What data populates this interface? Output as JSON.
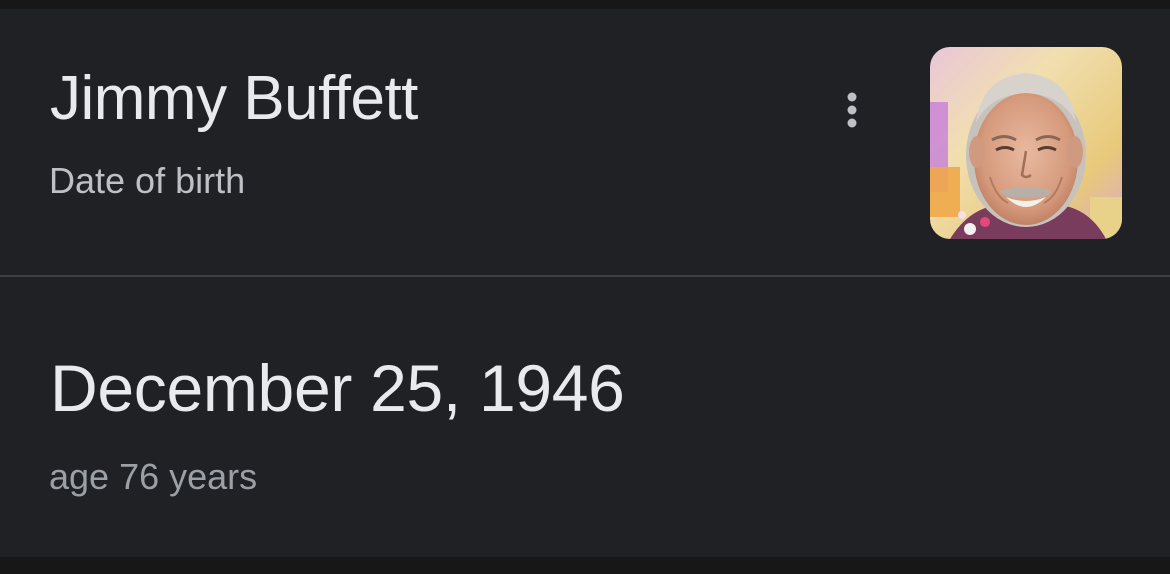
{
  "knowledge_panel": {
    "entity_name": "Jimmy Buffett",
    "attribute_label": "Date of birth",
    "more_options_icon": "three-dots-vertical-icon",
    "thumbnail": "portrait-photo",
    "answer": "December 25, 1946",
    "age_text": "age 76 years"
  },
  "colors": {
    "background": "#202124",
    "outer_background": "#171717",
    "divider": "#3c4043",
    "primary_text": "#e8eaed",
    "secondary_text": "#bdc1c6",
    "tertiary_text": "#9aa0a6"
  }
}
